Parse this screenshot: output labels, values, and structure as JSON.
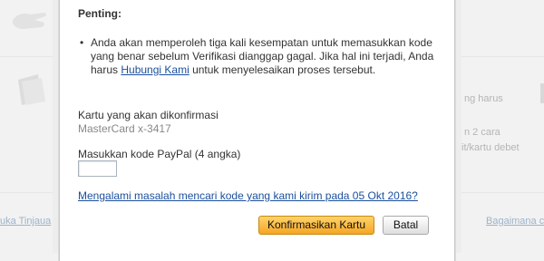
{
  "background": {
    "right_texts": [
      "ng harus",
      "n 2 cara",
      "it/kartu debet"
    ],
    "footer_left_link": "uka Tinjaua",
    "footer_right_link": "Bagaimana ca"
  },
  "dialog": {
    "title": "Penting:",
    "bullet_text_before": "Anda akan memperoleh tiga kali kesempatan untuk memasukkan kode yang benar sebelum Verifikasi dianggap gagal. Jika hal ini terjadi, Anda harus ",
    "bullet_link": "Hubungi Kami",
    "bullet_text_after": " untuk menyelesaikan proses tersebut.",
    "card_label": "Kartu yang akan dikonfirmasi",
    "card_value": "MasterCard x-3417",
    "code_label": "Masukkan kode PayPal (4 angka)",
    "code_value": "",
    "help_link": "Mengalami masalah mencari kode yang kami kirim pada 05 Okt 2016?",
    "confirm_button": "Konfirmasikan Kartu",
    "cancel_button": "Batal"
  },
  "colors": {
    "link": "#1b4f9c",
    "primary_button": "#f5a623"
  }
}
